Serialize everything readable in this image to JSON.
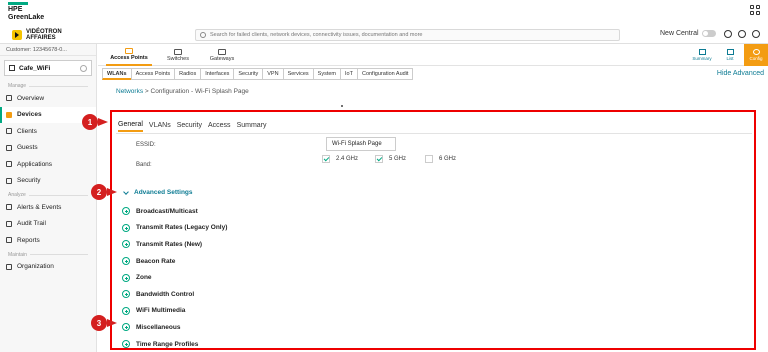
{
  "top": {
    "logo_line1": "HPE",
    "logo_line2": "GreenLake"
  },
  "header": {
    "brand_line1": "VIDÉOTRON",
    "brand_line2": "AFFAIRES",
    "search_placeholder": "Search for failed clients, network devices, connectivity issues, documentation and more",
    "new_central": "New Central"
  },
  "sidebar": {
    "customer": "Customer: 12345678-0...",
    "site": "Cafe_WiFi",
    "sections": {
      "manage": "Manage",
      "analyze": "Analyze",
      "maintain": "Maintain"
    },
    "items": [
      "Overview",
      "Devices",
      "Clients",
      "Guests",
      "Applications",
      "Security",
      "Alerts & Events",
      "Audit Trail",
      "Reports",
      "Organization"
    ]
  },
  "device_tabs": [
    "Access Points",
    "Switches",
    "Gateways"
  ],
  "right_buttons": [
    "Summary",
    "List",
    "Config"
  ],
  "subtabs": [
    "WLANs",
    "Access Points",
    "Radios",
    "Interfaces",
    "Security",
    "VPN",
    "Services",
    "System",
    "IoT",
    "Configuration Audit"
  ],
  "hide_advanced": "Hide Advanced",
  "breadcrumb": {
    "link": "Networks",
    "rest": " > Configuration - Wi-Fi Splash Page"
  },
  "panel": {
    "tabs": [
      "General",
      "VLANs",
      "Security",
      "Access",
      "Summary"
    ],
    "essid_label": "ESSID:",
    "essid_value": "Wi-Fi Splash Page",
    "band_label": "Band:",
    "bands": [
      {
        "label": "2.4 GHz",
        "checked": true
      },
      {
        "label": "5 GHz",
        "checked": true
      },
      {
        "label": "6 GHz",
        "checked": false
      }
    ],
    "advanced_title": "Advanced Settings",
    "advanced_items": [
      "Broadcast/Multicast",
      "Transmit Rates (Legacy Only)",
      "Transmit Rates (New)",
      "Beacon Rate",
      "Zone",
      "Bandwidth Control",
      "WiFi Multimedia",
      "Miscellaneous",
      "Time Range Profiles"
    ]
  },
  "callouts": [
    "1",
    "2",
    "3"
  ],
  "colors": {
    "accent": "#f39c12",
    "brand_green": "#01a982",
    "link": "#0c7b93",
    "callout": "#d41f1f"
  }
}
